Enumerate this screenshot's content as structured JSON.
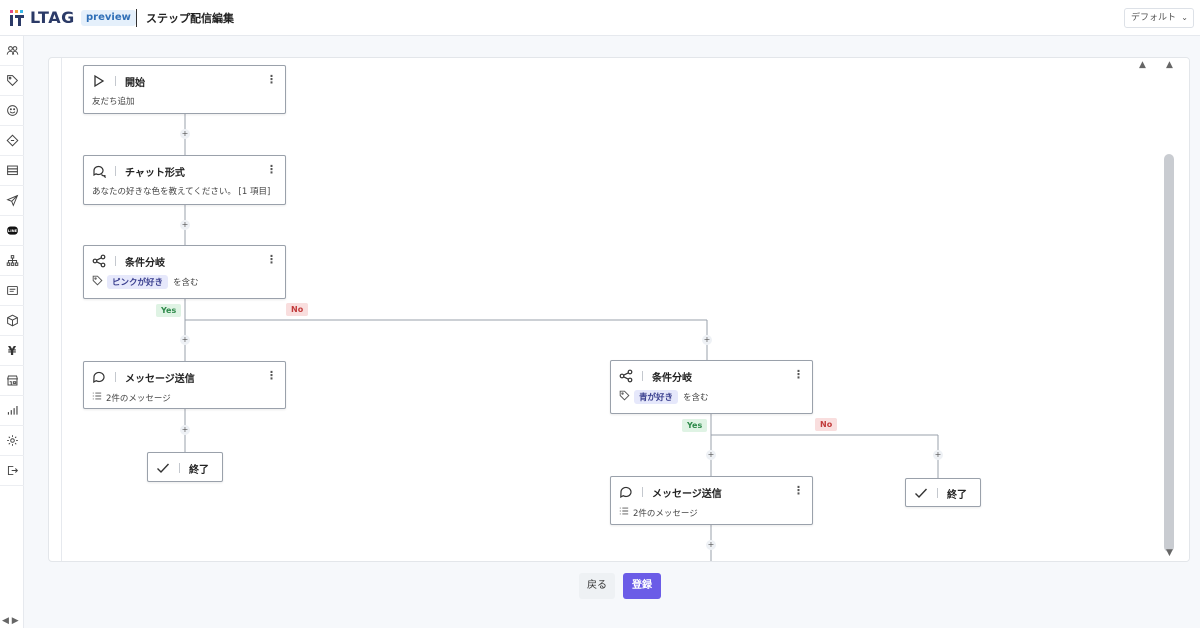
{
  "header": {
    "logo_text": "LTAG",
    "badge": "preview",
    "title": "ステップ配信編集",
    "profile": "デフォルト",
    "profile_chevron": "⌄"
  },
  "colors": {
    "accent": "#6b5ce7",
    "yes_bg": "#dff3e4",
    "no_bg": "#f9dede",
    "tag_bg": "#e6e8fb"
  },
  "sidebar": {
    "items": [
      {
        "icon": "users-icon"
      },
      {
        "icon": "tag-icon"
      },
      {
        "icon": "smile-icon"
      },
      {
        "icon": "ticket-icon"
      },
      {
        "icon": "database-icon"
      },
      {
        "icon": "send-icon"
      },
      {
        "icon": "line-icon"
      },
      {
        "icon": "sitemap-icon"
      },
      {
        "icon": "form-icon"
      },
      {
        "icon": "box-icon"
      },
      {
        "icon": "yen-icon",
        "glyph": "¥"
      },
      {
        "icon": "store-icon"
      },
      {
        "icon": "chart-icon"
      },
      {
        "icon": "gear-icon"
      },
      {
        "icon": "logout-icon"
      }
    ],
    "bottom": "◀ ▶"
  },
  "flow": {
    "start": {
      "title": "開始",
      "sub": "友だち追加"
    },
    "chat": {
      "title": "チャット形式",
      "sub": "あなたの好きな色を教えてください。 [1 項目]"
    },
    "branch1": {
      "title": "条件分岐",
      "tag": "ピンクが好き",
      "suffix": "を含む"
    },
    "msg1": {
      "title": "メッセージ送信",
      "sub": "2件のメッセージ"
    },
    "end1": {
      "title": "終了"
    },
    "branch2": {
      "title": "条件分岐",
      "tag": "青が好き",
      "suffix": "を含む"
    },
    "msg2": {
      "title": "メッセージ送信",
      "sub": "2件のメッセージ"
    },
    "end2": {
      "title": "終了"
    },
    "yes": "Yes",
    "no": "No",
    "plus": "+",
    "kebab": "⋮"
  },
  "footer": {
    "back": "戻る",
    "save": "登録"
  }
}
